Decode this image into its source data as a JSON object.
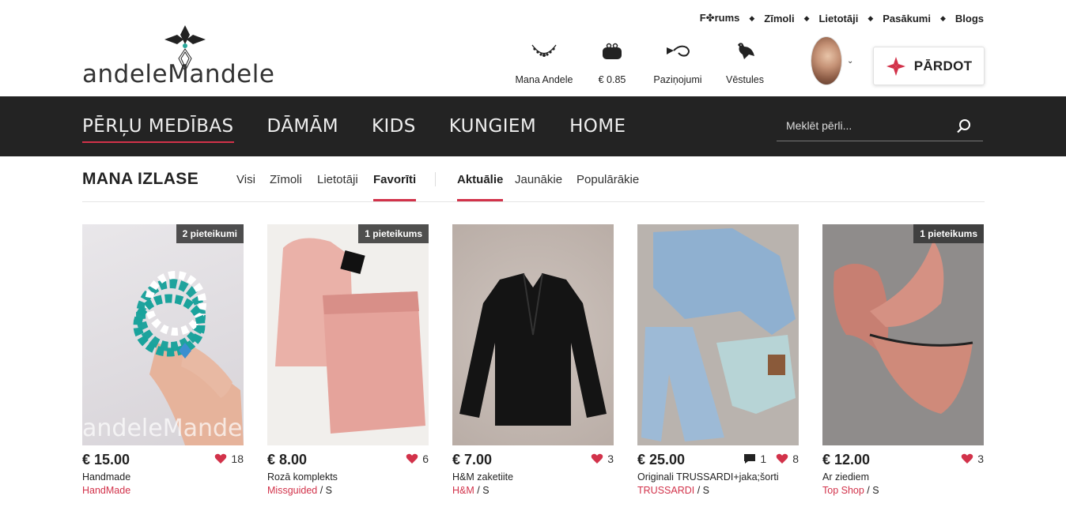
{
  "logo": {
    "text_a": "andele",
    "text_m": "M",
    "text_b": "andele"
  },
  "toplinks": [
    "F✤rums",
    "Zīmoli",
    "Lietotāji",
    "Pasākumi",
    "Blogs"
  ],
  "usernav": [
    {
      "label": "Mana Andele",
      "icon": "necklace-icon"
    },
    {
      "label": "€ 0.85",
      "icon": "wallet-icon"
    },
    {
      "label": "Paziņojumi",
      "icon": "horn-icon"
    },
    {
      "label": "Vēstules",
      "icon": "pigeon-icon"
    }
  ],
  "sell_label": "PĀRDOT",
  "categories": [
    "PĒRĻU MEDĪBAS",
    "DĀMĀM",
    "KIDS",
    "KUNGIEM",
    "HOME"
  ],
  "search": {
    "placeholder": "Meklēt pērli..."
  },
  "filter": {
    "title": "MANA IZLASE",
    "tabs1": [
      "Visi",
      "Zīmoli",
      "Lietotāji",
      "Favorīti"
    ],
    "tabs2": [
      "Aktuālie",
      "Jaunākie",
      "Populārākie"
    ]
  },
  "products": [
    {
      "price": "€ 15.00",
      "likes": "18",
      "comments": "",
      "name": "Handmade",
      "brand": "HandMade",
      "size": "",
      "badge": "2 pieteikumi"
    },
    {
      "price": "€ 8.00",
      "likes": "6",
      "comments": "",
      "name": "Rozā komplekts",
      "brand": "Missguided",
      "size": " / S",
      "badge": "1 pieteikums"
    },
    {
      "price": "€ 7.00",
      "likes": "3",
      "comments": "",
      "name": "H&M zaketiite",
      "brand": "H&M",
      "size": " / S",
      "badge": ""
    },
    {
      "price": "€ 25.00",
      "likes": "8",
      "comments": "1",
      "name": "Originali TRUSSARDI+jaka;šorti",
      "brand": "TRUSSARDI",
      "size": " / S",
      "badge": ""
    },
    {
      "price": "€ 12.00",
      "likes": "3",
      "comments": "",
      "name": "Ar ziediem",
      "brand": "Top Shop",
      "size": " / S",
      "badge": "1 pieteikums"
    }
  ],
  "colors": {
    "accent": "#d2324a",
    "nav_bg": "#232323"
  }
}
